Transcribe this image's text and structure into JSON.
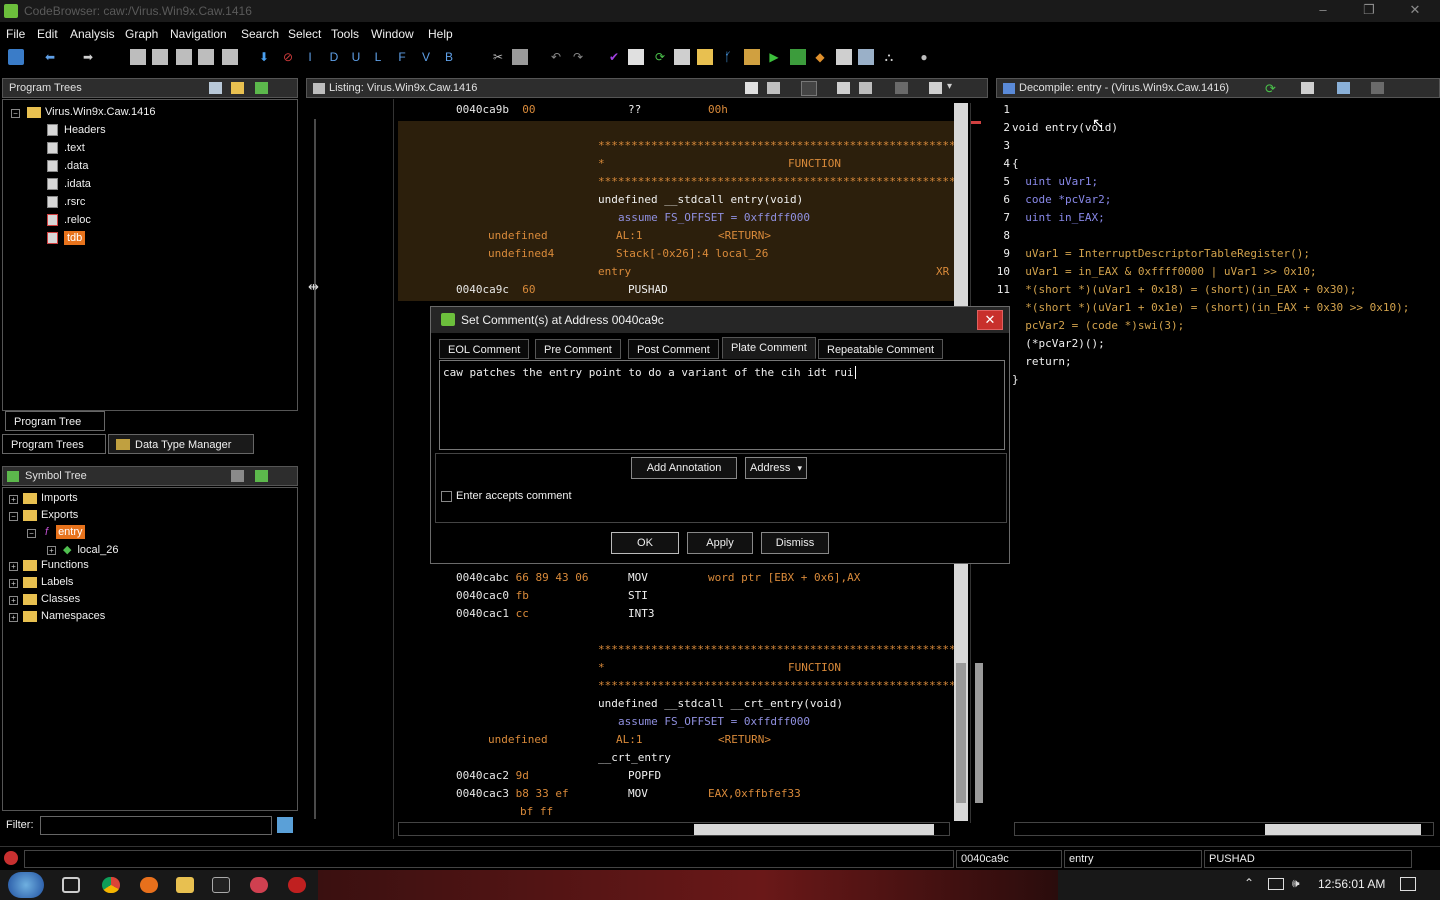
{
  "window": {
    "title": "CodeBrowser: caw:/Virus.Win9x.Caw.1416",
    "controls": [
      "–",
      "❐",
      "✕"
    ]
  },
  "menu": [
    "File",
    "Edit",
    "Analysis",
    "Graph",
    "Navigation",
    "Search",
    "Select",
    "Tools",
    "Window",
    "Help"
  ],
  "toolbar_letters": [
    "I",
    "D",
    "U",
    "L",
    "F",
    "V",
    "B"
  ],
  "program_trees": {
    "title": "Program Trees",
    "root": "Virus.Win9x.Caw.1416",
    "items": [
      "Headers",
      ".text",
      ".data",
      ".idata",
      ".rsrc",
      ".reloc",
      "tdb"
    ],
    "inner_tab": "Program Tree",
    "bottom_tabs": [
      "Program Trees",
      "Data Type Manager"
    ]
  },
  "symbol_tree": {
    "title": "Symbol Tree",
    "items": [
      {
        "label": "Imports"
      },
      {
        "label": "Exports"
      },
      {
        "label": "entry"
      },
      {
        "label": "local_26"
      },
      {
        "label": "Functions"
      },
      {
        "label": "Labels"
      },
      {
        "label": "Classes"
      },
      {
        "label": "Namespaces"
      }
    ],
    "filter_label": "Filter:"
  },
  "listing": {
    "title": "Listing:  Virus.Win9x.Caw.1416",
    "rows_top": [
      {
        "addr": "0040ca9b",
        "bytes": "00",
        "mn": "??",
        "op": "00h"
      },
      {
        "stars": "**************************************************************"
      },
      {
        "star_label": "*",
        "func_label": "FUNCTION"
      },
      {
        "stars": "**************************************************************"
      },
      {
        "sig": "undefined __stdcall entry(void)"
      },
      {
        "assume": "assume FS_OFFSET = 0xffdff000"
      },
      {
        "type": "undefined",
        "loc": "AL:1",
        "ret": "<RETURN>"
      },
      {
        "type": "undefined4",
        "loc": "Stack[-0x26]:4 local_26"
      },
      {
        "label": "entry",
        "xref": "XR"
      },
      {
        "addr": "0040ca9c",
        "bytes": "60",
        "mn": "PUSHAD"
      }
    ],
    "rows_bottom": [
      {
        "addr": "0040cabc",
        "bytes": "66 89 43 06",
        "mn": "MOV",
        "op": "word ptr [EBX + 0x6],AX"
      },
      {
        "addr": "0040cac0",
        "bytes": "fb",
        "mn": "STI"
      },
      {
        "addr": "0040cac1",
        "bytes": "cc",
        "mn": "INT3"
      },
      {
        "stars": "**************************************************************"
      },
      {
        "star_label": "*",
        "func_label": "FUNCTION"
      },
      {
        "stars": "**************************************************************"
      },
      {
        "sig": "undefined __stdcall __crt_entry(void)"
      },
      {
        "assume": "assume FS_OFFSET = 0xffdff000"
      },
      {
        "type": "undefined",
        "loc": "AL:1",
        "ret": "<RETURN>"
      },
      {
        "label": "__crt_entry"
      },
      {
        "addr": "0040cac2",
        "bytes": "9d",
        "mn": "POPFD"
      },
      {
        "addr": "0040cac3",
        "bytes": "b8 33 ef",
        "mn": "MOV",
        "op": "EAX,0xffbfef33"
      },
      {
        "bytes": "bf ff"
      }
    ]
  },
  "decompile": {
    "title": "Decompile: entry -  (Virus.Win9x.Caw.1416)",
    "lines": [
      "1",
      "2",
      "3",
      "4",
      "5",
      "6",
      "7",
      "8",
      "9",
      "10",
      "11"
    ],
    "code": [
      "",
      "void entry(void)",
      "",
      "{",
      "  uint uVar1;",
      "  code *pcVar2;",
      "  uint in_EAX;",
      "",
      "  uVar1 = InterruptDescriptorTableRegister();",
      "  uVar1 = in_EAX & 0xffff0000 | uVar1 >> 0x10;",
      "  *(short *)(uVar1 + 0x18) = (short)(in_EAX + 0x30);",
      "  *(short *)(uVar1 + 0x1e) = (short)(in_EAX + 0x30 >> 0x10);",
      "  pcVar2 = (code *)swi(3);",
      "  (*pcVar2)();",
      "  return;",
      "}"
    ]
  },
  "dialog": {
    "title": "Set Comment(s) at Address 0040ca9c",
    "tabs": [
      "EOL Comment",
      "Pre Comment",
      "Post Comment",
      "Plate Comment",
      "Repeatable Comment"
    ],
    "active_tab": "Plate Comment",
    "comment_text": "caw patches the entry point to do a variant of the cih idt rui",
    "add_annotation": "Add Annotation",
    "annotation_type": "Address",
    "enter_accepts": "Enter accepts comment",
    "enter_accepts_checked": false,
    "buttons": {
      "ok": "OK",
      "apply": "Apply",
      "dismiss": "Dismiss"
    }
  },
  "status": {
    "address": "0040ca9c",
    "function": "entry",
    "instruction": "PUSHAD"
  },
  "taskbar": {
    "time": "12:56:01 AM"
  },
  "colors": {
    "accent_orange": "#d98a3a",
    "var_blue": "#8888e8",
    "close_red": "#c8302c"
  }
}
